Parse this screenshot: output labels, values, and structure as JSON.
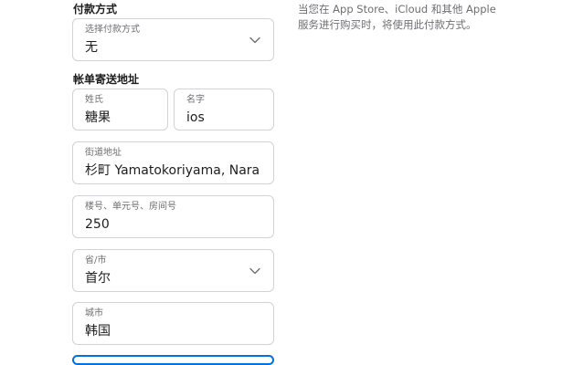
{
  "payment": {
    "section_title": "付款方式",
    "method_label": "选择付款方式",
    "method_value": "无",
    "info_text": "当您在 App Store、iCloud 和其他 Apple 服务进行购买时，将使用此付款方式。"
  },
  "billing": {
    "section_title": "帐单寄送地址",
    "last_name_label": "姓氏",
    "last_name_value": "糖果",
    "first_name_label": "名字",
    "first_name_value": "ios",
    "street_label": "街道地址",
    "street_value": "杉町 Yamatokoriyama, Nara Prefecture",
    "unit_label": "楼号、单元号、房间号",
    "unit_value": "250",
    "province_label": "省/市",
    "province_value": "首尔",
    "city_label": "城市",
    "city_value": "韩国"
  },
  "colors": {
    "focus_border": "#0071e3",
    "field_border": "#d2d2d7",
    "label_gray": "#6e6e73"
  }
}
